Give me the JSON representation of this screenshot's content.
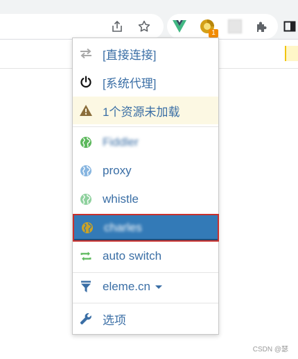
{
  "popup": {
    "items": [
      {
        "label": "[直接连接]"
      },
      {
        "label": "[系统代理]"
      },
      {
        "label": "1个资源未加载"
      },
      {
        "label": "Fiddler"
      },
      {
        "label": "proxy"
      },
      {
        "label": "whistle"
      },
      {
        "label": "charles"
      },
      {
        "label": "auto switch"
      },
      {
        "label": "eleme.cn"
      },
      {
        "label": "选项"
      }
    ]
  },
  "extension": {
    "badge_count": "1"
  },
  "colors": {
    "link": "#3a6ea5",
    "selected_bg": "#337ab7",
    "selected_border": "#c9302c",
    "warning_bg": "#fcf8e3",
    "warning_icon": "#8a6d3b",
    "globe_green": "#5cb85c",
    "globe_light_blue": "#87b5e0",
    "globe_light_green": "#8fd19e",
    "globe_gold": "#c9a227",
    "auto_switch_green": "#5cb85c"
  },
  "watermark": "CSDN @瑟"
}
